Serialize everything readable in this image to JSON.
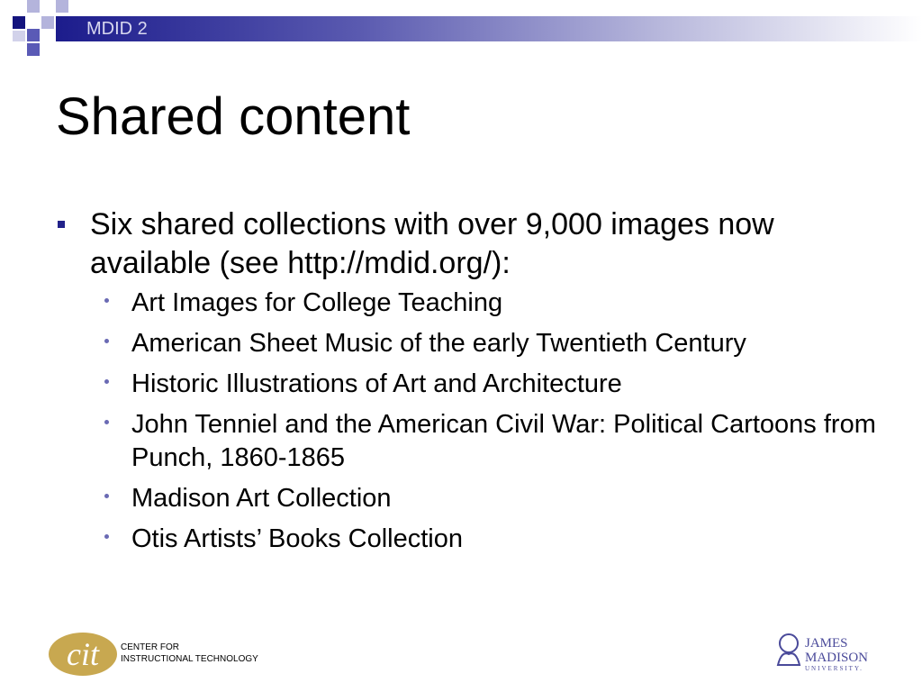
{
  "header": {
    "label": "MDID 2"
  },
  "slide": {
    "title": "Shared content",
    "bullet": "Six shared collections with over 9,000 images now available (see http://mdid.org/):",
    "collections": [
      "Art Images for College Teaching",
      "American Sheet Music of the early Twentieth Century",
      "Historic Illustrations of Art and Architecture",
      "John Tenniel and the American Civil War: Political Cartoons from Punch, 1860-1865",
      "Madison Art Collection",
      "Otis Artists’ Books Collection"
    ]
  },
  "footer": {
    "cit_line1": "CENTER FOR",
    "cit_line2": "INSTRUCTIONAL TECHNOLOGY",
    "cit_logo_text": "cit",
    "jmu_line1": "JAMES",
    "jmu_line2": "MADISON",
    "jmu_line3": "UNIVERSITY."
  },
  "colors": {
    "accent": "#22228a",
    "header_dark": "#14147e",
    "cit_gold": "#c8a850"
  }
}
